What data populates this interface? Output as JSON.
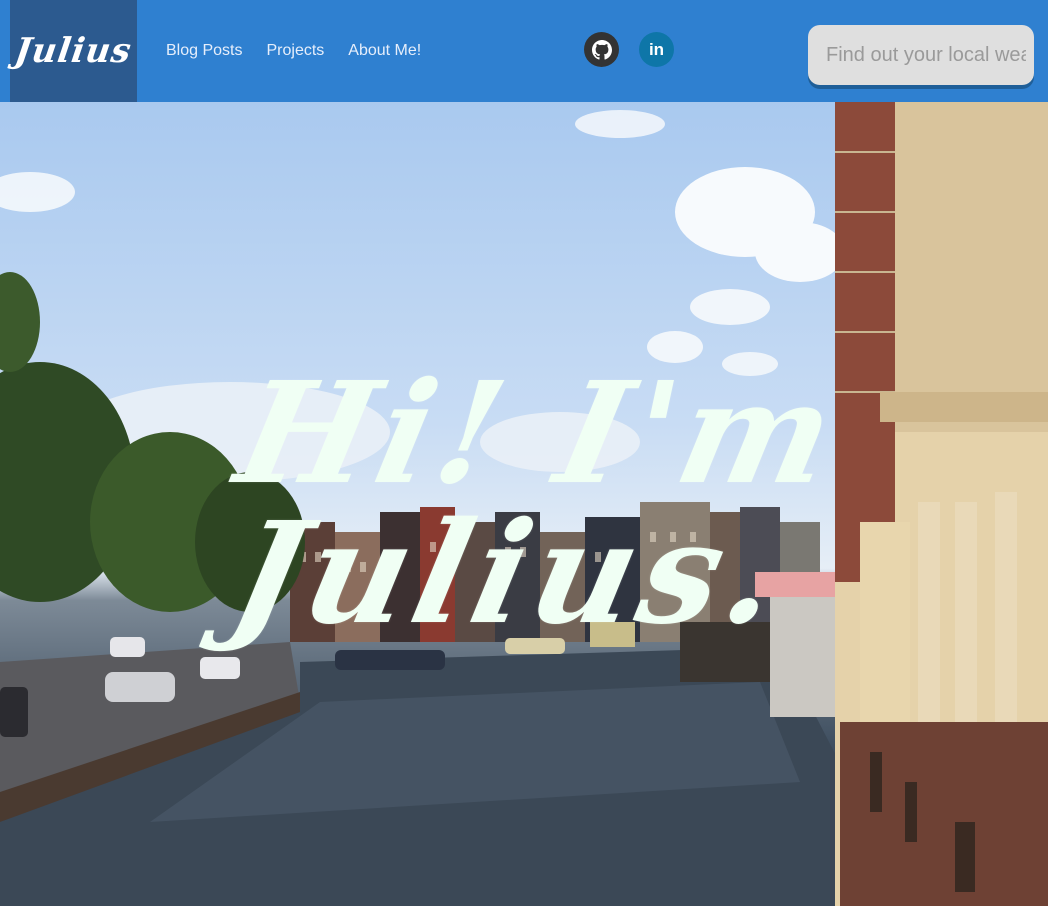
{
  "navbar": {
    "brand": "Julius",
    "links": [
      {
        "label": "Blog Posts"
      },
      {
        "label": "Projects"
      },
      {
        "label": "About Me!"
      }
    ],
    "social": {
      "github_icon": "github-icon",
      "linkedin_icon": "linkedin-icon",
      "linkedin_text": "in"
    },
    "search": {
      "placeholder": "Find out your local weather"
    }
  },
  "hero": {
    "headline": "Hi! I'm Julius."
  },
  "colors": {
    "navbar": "#2f80d0",
    "brand_bg": "#2c5a8f",
    "github": "#333333",
    "linkedin": "#0e76a8",
    "headline": "#f0fff4"
  }
}
